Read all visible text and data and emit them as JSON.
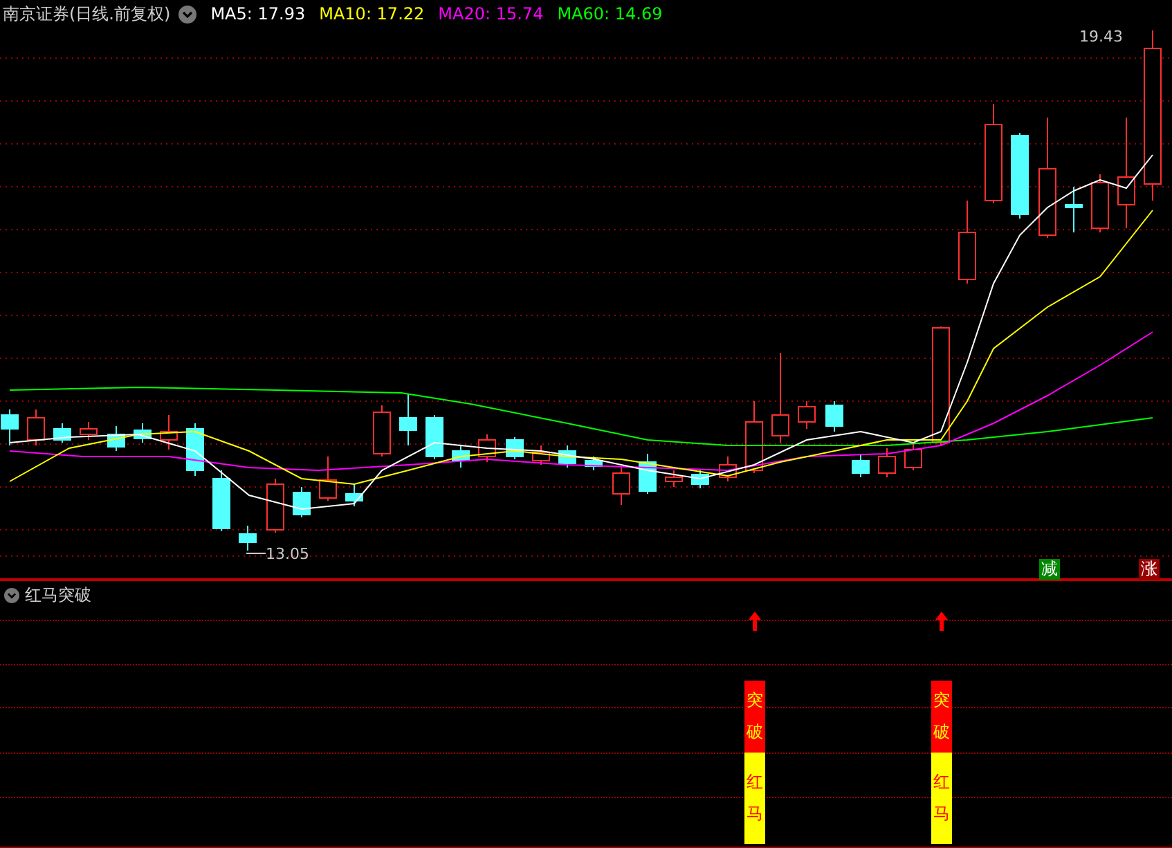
{
  "title": "南京证券(日线.前复权)",
  "moving_averages": [
    {
      "label": "MA5: 17.93",
      "color": "#ffffff"
    },
    {
      "label": "MA10: 17.22",
      "color": "#ffff00"
    },
    {
      "label": "MA20: 15.74",
      "color": "#ff00ff"
    },
    {
      "label": "MA60: 14.69",
      "color": "#00ff00"
    }
  ],
  "price_labels": {
    "high": "19.43",
    "low": "13.05"
  },
  "badges": [
    {
      "text": "减",
      "color": "#008800"
    },
    {
      "text": "涨",
      "color": "#990000"
    }
  ],
  "indicator": {
    "title": "红马突破",
    "signals": [
      {
        "upper": "突破",
        "lower": "红马"
      },
      {
        "upper": "突破",
        "lower": "红马"
      }
    ]
  }
}
